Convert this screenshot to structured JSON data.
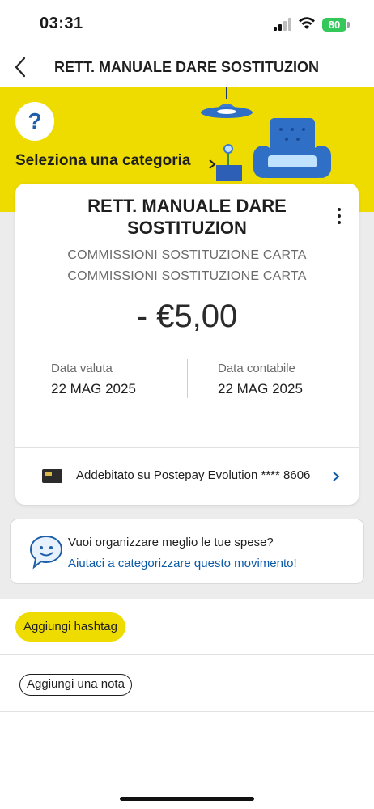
{
  "status_bar": {
    "time": "03:31",
    "battery": "80"
  },
  "nav": {
    "title": "RETT. MANUALE DARE SOSTITUZION"
  },
  "banner": {
    "help_symbol": "?",
    "category_label": "Seleziona una categoria"
  },
  "transaction": {
    "title_line1": "RETT. MANUALE DARE",
    "title_line2": "SOSTITUZION",
    "description_1": "COMMISSIONI SOSTITUZIONE CARTA",
    "description_2": "COMMISSIONI SOSTITUZIONE CARTA",
    "amount": "- €5,00",
    "value_date_label": "Data valuta",
    "value_date": "22 MAG 2025",
    "accounting_date_label": "Data contabile",
    "accounting_date": "22 MAG 2025",
    "charged_on": "Addebitato su Postepay Evolution **** 8606"
  },
  "tip": {
    "question": "Vuoi organizzare meglio le tue spese?",
    "link": "Aiutaci a categorizzare questo movimento!"
  },
  "actions": {
    "hashtag_label": "Aggiungi hashtag",
    "note_label": "Aggiungi una nota"
  },
  "colors": {
    "brand_yellow": "#eedc00",
    "link_blue": "#0b5aa8",
    "icon_blue": "#1f5fa8",
    "battery_green": "#34c759"
  },
  "icons": [
    "back-chevron-icon",
    "help-icon",
    "lamp-icon",
    "armchair-icon",
    "plant-icon",
    "more-options-icon",
    "card-icon",
    "chevron-right-icon",
    "chat-smile-icon"
  ]
}
